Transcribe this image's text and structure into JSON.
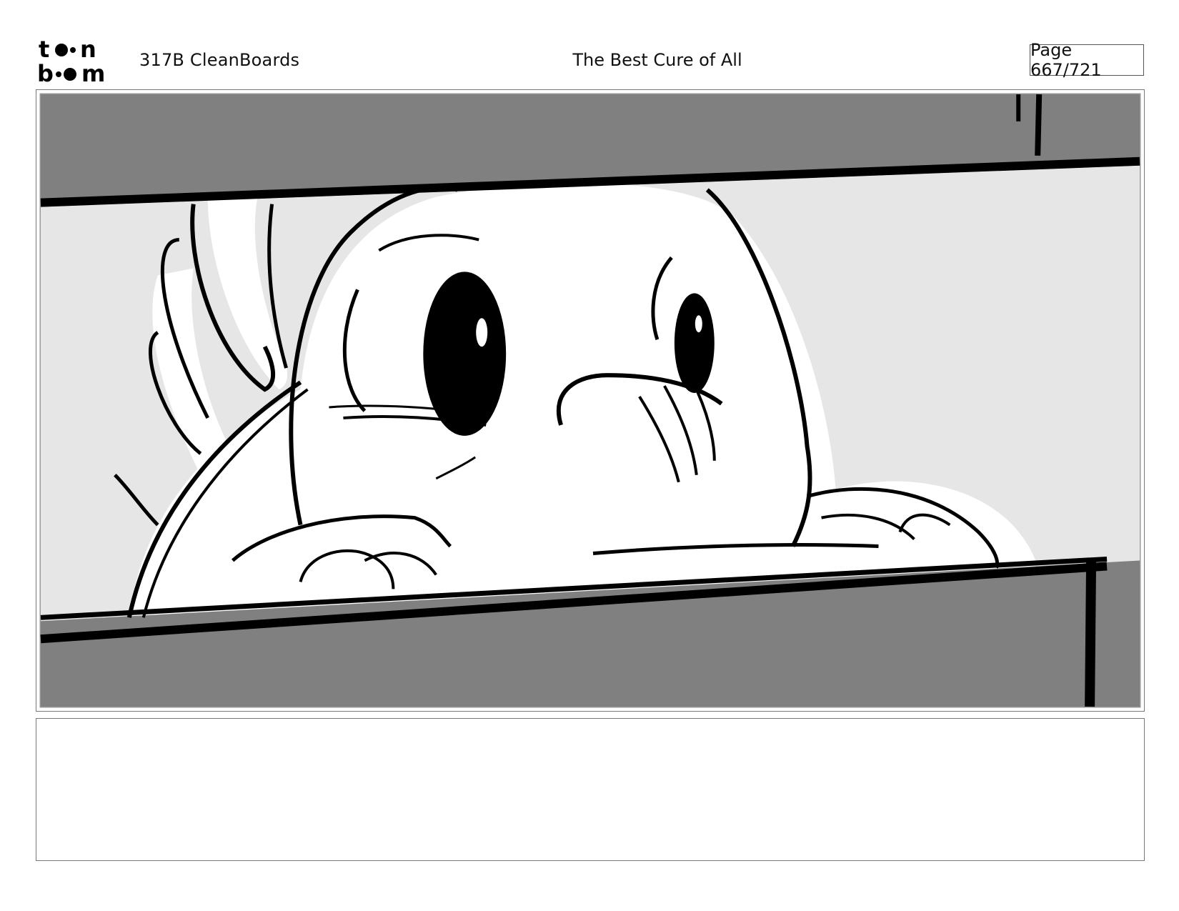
{
  "header": {
    "logo_text": "toon boom",
    "production": "317B  CleanBoards",
    "title": "The Best Cure of All",
    "page_label": "Page 667/721"
  },
  "panel": {
    "image_description_icon": "storyboard-drawing-icon"
  },
  "notes": {
    "text": ""
  },
  "colors": {
    "border": "#777777",
    "shelf_gray": "#808080",
    "background_gray": "#e5e5e5",
    "ink": "#000000"
  }
}
